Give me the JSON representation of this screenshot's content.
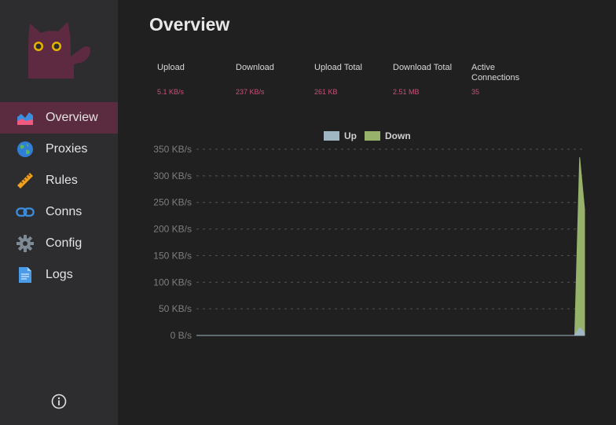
{
  "sidebar": {
    "logo_icon": "cat-logo-icon",
    "items": [
      {
        "label": "Overview",
        "icon": "chart-area-icon",
        "active": true
      },
      {
        "label": "Proxies",
        "icon": "globe-icon"
      },
      {
        "label": "Rules",
        "icon": "ruler-icon"
      },
      {
        "label": "Conns",
        "icon": "link-icon"
      },
      {
        "label": "Config",
        "icon": "gear-icon"
      },
      {
        "label": "Logs",
        "icon": "document-icon"
      }
    ],
    "footer_icon": "info-icon"
  },
  "page": {
    "title": "Overview"
  },
  "stats": [
    {
      "label": "Upload",
      "value": "5.1 KB/s"
    },
    {
      "label": "Download",
      "value": "237 KB/s"
    },
    {
      "label": "Upload Total",
      "value": "261 KB"
    },
    {
      "label": "Download Total",
      "value": "2.51 MB"
    },
    {
      "label": "Active Connections",
      "value": "35"
    }
  ],
  "colors": {
    "accent": "#c4527a",
    "up": "#9fb7c3",
    "down": "#97b26a",
    "active_nav": "#5b2b3f"
  },
  "chart_data": {
    "type": "area",
    "legend": [
      "Up",
      "Down"
    ],
    "y_ticks": [
      "350 KB/s",
      "300 KB/s",
      "250 KB/s",
      "200 KB/s",
      "150 KB/s",
      "100 KB/s",
      "50 KB/s",
      "0 B/s"
    ],
    "ylim": [
      0,
      350
    ],
    "grid": true,
    "legend_position": "top",
    "series": [
      {
        "name": "Up",
        "values": [
          0,
          0,
          0,
          0,
          0,
          0,
          0,
          0,
          0,
          0,
          0,
          0,
          0,
          0,
          0,
          0,
          0,
          0,
          0,
          0,
          0,
          0,
          0,
          0,
          0,
          0,
          0,
          0,
          0,
          0,
          0,
          0,
          0,
          0,
          0,
          0,
          0,
          0,
          0,
          0,
          0,
          0,
          0,
          0,
          0,
          0,
          0,
          0,
          0,
          0,
          0,
          0,
          0,
          0,
          0,
          0,
          0,
          0,
          0,
          0,
          0,
          0,
          0,
          0,
          0,
          0,
          0,
          0,
          0,
          0,
          0,
          0,
          0,
          0,
          0,
          0,
          0,
          0,
          15,
          5.1
        ]
      },
      {
        "name": "Down",
        "values": [
          0,
          0,
          0,
          0,
          0,
          0,
          0,
          0,
          0,
          0,
          0,
          0,
          0,
          0,
          0,
          0,
          0,
          0,
          0,
          0,
          0,
          0,
          0,
          0,
          0,
          0,
          0,
          0,
          0,
          0,
          0,
          0,
          0,
          0,
          0,
          0,
          0,
          0,
          0,
          0,
          0,
          0,
          0,
          0,
          0,
          0,
          0,
          0,
          0,
          0,
          0,
          0,
          0,
          0,
          0,
          0,
          0,
          0,
          0,
          0,
          0,
          0,
          0,
          0,
          0,
          0,
          0,
          0,
          0,
          0,
          0,
          0,
          0,
          0,
          0,
          0,
          0,
          0,
          335,
          237
        ]
      }
    ]
  }
}
